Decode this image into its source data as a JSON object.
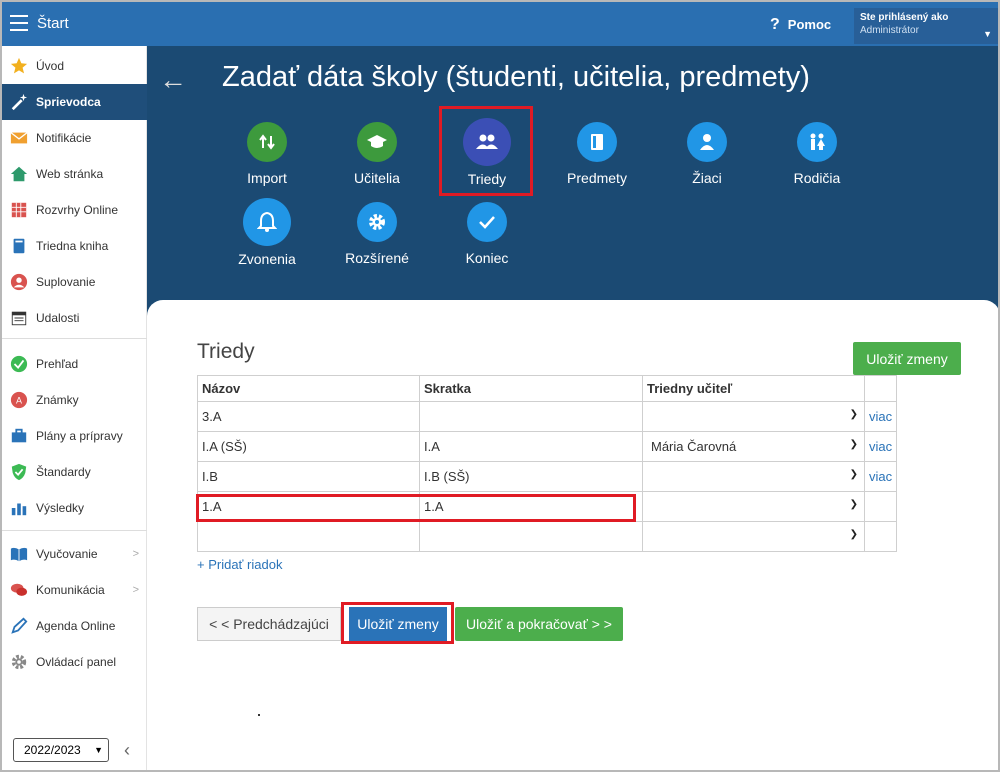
{
  "topbar": {
    "app_title": "Štart",
    "help": "Pomoc",
    "help_mark": "?",
    "user_line1": "Ste prihlásený ako",
    "user_line2": "Administrátor"
  },
  "sidebar": {
    "items": [
      {
        "label": "Úvod",
        "icon": "star-icon"
      },
      {
        "label": "Sprievodca",
        "icon": "magic-wand-icon"
      },
      {
        "label": "Notifikácie",
        "icon": "envelope-icon"
      },
      {
        "label": "Web stránka",
        "icon": "home-icon"
      },
      {
        "label": "Rozvrhy Online",
        "icon": "calendar-grid-icon"
      },
      {
        "label": "Triedna kniha",
        "icon": "book-icon"
      },
      {
        "label": "Suplovanie",
        "icon": "person-icon"
      },
      {
        "label": "Udalosti",
        "icon": "calendar-icon"
      },
      {
        "label": "Prehľad",
        "icon": "check-circle-icon"
      },
      {
        "label": "Známky",
        "icon": "grade-icon"
      },
      {
        "label": "Plány a prípravy",
        "icon": "briefcase-icon"
      },
      {
        "label": "Štandardy",
        "icon": "shield-check-icon"
      },
      {
        "label": "Výsledky",
        "icon": "bar-chart-icon"
      },
      {
        "label": "Vyučovanie",
        "icon": "open-book-icon"
      },
      {
        "label": "Komunikácia",
        "icon": "chat-icon"
      },
      {
        "label": "Agenda Online",
        "icon": "pen-icon"
      },
      {
        "label": "Ovládací panel",
        "icon": "gear-icon"
      }
    ],
    "year": "2022/2023"
  },
  "header": {
    "title": "Zadať dáta školy (študenti, učitelia, predmety)"
  },
  "wizard": [
    {
      "label": "Import",
      "color": "#3d9a3d",
      "icon": "import-arrows-icon"
    },
    {
      "label": "Učitelia",
      "color": "#3d9a3d",
      "icon": "graduation-cap-icon"
    },
    {
      "label": "Triedy",
      "color": "#3b4fb5",
      "icon": "group-icon"
    },
    {
      "label": "Predmety",
      "color": "#2196e6",
      "icon": "book-icon"
    },
    {
      "label": "Žiaci",
      "color": "#2196e6",
      "icon": "person-icon"
    },
    {
      "label": "Rodičia",
      "color": "#2196e6",
      "icon": "parents-icon"
    },
    {
      "label": "Zvonenia",
      "color": "#2196e6",
      "icon": "bell-icon"
    },
    {
      "label": "Rozšírené",
      "color": "#2196e6",
      "icon": "gear-icon"
    },
    {
      "label": "Koniec",
      "color": "#2196e6",
      "icon": "check-icon"
    }
  ],
  "section": {
    "title": "Triedy",
    "save_top": "Uložiť zmeny"
  },
  "table": {
    "headers": [
      "Názov",
      "Skratka",
      "Triedny učiteľ"
    ],
    "rows": [
      {
        "name": "3.A",
        "abbr": "",
        "teacher": "",
        "more": "viac"
      },
      {
        "name": "I.A (SŠ)",
        "abbr": "I.A",
        "teacher": "Mária Čarovná",
        "more": "viac"
      },
      {
        "name": "I.B",
        "abbr": "I.B (SŠ)",
        "teacher": "",
        "more": "viac"
      },
      {
        "name": "1.A",
        "abbr": "1.A",
        "teacher": "",
        "more": ""
      },
      {
        "name": "",
        "abbr": "",
        "teacher": "",
        "more": ""
      }
    ]
  },
  "add_row": "+ Pridať riadok",
  "buttons": {
    "prev": "< < Predchádzajúci",
    "save": "Uložiť zmeny",
    "save_continue": "Uložiť a pokračovať > >"
  }
}
